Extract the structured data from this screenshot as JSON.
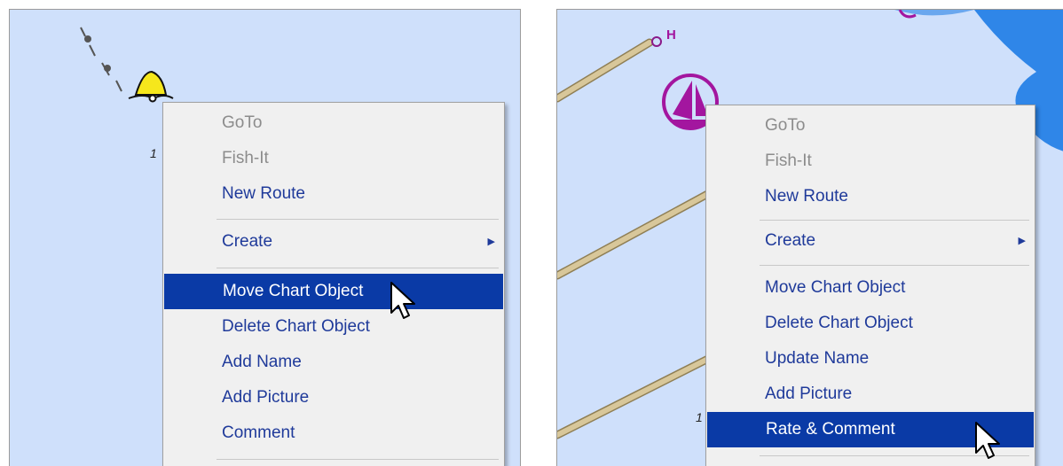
{
  "left_menu": {
    "items": [
      {
        "label": "GoTo",
        "state": "disabled"
      },
      {
        "label": "Fish-It",
        "state": "disabled"
      },
      {
        "label": "New Route",
        "state": "normal"
      },
      {
        "label": "Create",
        "state": "submenu"
      },
      {
        "label": "Move Chart Object",
        "state": "highlighted"
      },
      {
        "label": "Delete Chart Object",
        "state": "normal"
      },
      {
        "label": "Add Name",
        "state": "normal"
      },
      {
        "label": "Add Picture",
        "state": "normal"
      },
      {
        "label": "Comment",
        "state": "normal"
      }
    ]
  },
  "right_menu": {
    "items": [
      {
        "label": "GoTo",
        "state": "disabled"
      },
      {
        "label": "Fish-It",
        "state": "disabled"
      },
      {
        "label": "New Route",
        "state": "normal"
      },
      {
        "label": "Create",
        "state": "submenu"
      },
      {
        "label": "Move Chart Object",
        "state": "normal"
      },
      {
        "label": "Delete Chart Object",
        "state": "normal"
      },
      {
        "label": "Update Name",
        "state": "normal"
      },
      {
        "label": "Add Picture",
        "state": "normal"
      },
      {
        "label": "Rate & Comment",
        "state": "highlighted"
      }
    ]
  },
  "chart": {
    "left_depth_label": "1",
    "right_depth_label": "1",
    "right_marker_label": "H"
  },
  "colors": {
    "water": "#cfe0fb",
    "deep_water": "#2f86e8",
    "menu_bg": "#f0f0f0",
    "menu_text": "#1f3a9a",
    "disabled_text": "#8c8c8c",
    "highlight": "#0a3aa6",
    "buoy_yellow": "#f6e71c",
    "marker_purple": "#a3169f",
    "cable_tan": "#d8c79a"
  }
}
